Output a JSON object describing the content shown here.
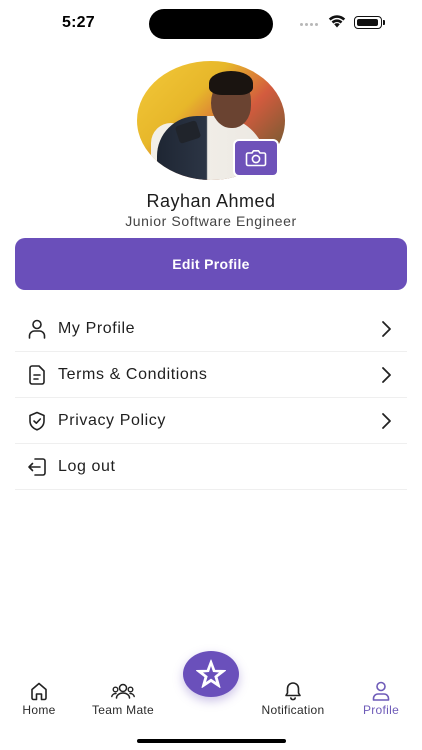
{
  "status_bar": {
    "time": "5:27"
  },
  "profile": {
    "name": "Rayhan Ahmed",
    "role": "Junior Software Engineer",
    "edit_label": "Edit Profile"
  },
  "menu": {
    "items": [
      {
        "label": "My Profile",
        "icon": "user-icon",
        "has_chevron": true
      },
      {
        "label": "Terms & Conditions",
        "icon": "document-icon",
        "has_chevron": true
      },
      {
        "label": "Privacy Policy",
        "icon": "shield-icon",
        "has_chevron": true
      },
      {
        "label": "Log out",
        "icon": "logout-icon",
        "has_chevron": false
      }
    ]
  },
  "bottom_nav": {
    "items": [
      {
        "label": "Home",
        "icon": "home-icon",
        "active": false
      },
      {
        "label": "Team Mate",
        "icon": "team-icon",
        "active": false
      },
      {
        "label": "Notification",
        "icon": "bell-icon",
        "active": false
      },
      {
        "label": "Profile",
        "icon": "profile-icon",
        "active": true
      }
    ],
    "center_icon": "star-icon"
  },
  "colors": {
    "accent": "#6a4fba",
    "active_nav": "#6e5bb8"
  }
}
